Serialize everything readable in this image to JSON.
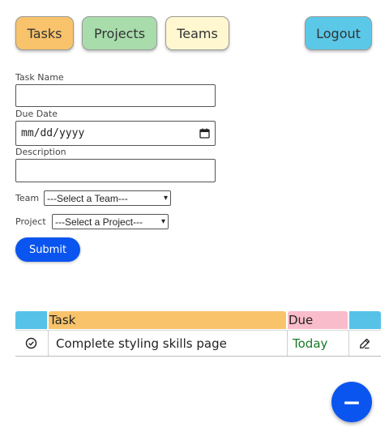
{
  "nav": {
    "tasks": "Tasks",
    "projects": "Projects",
    "teams": "Teams",
    "logout": "Logout"
  },
  "form": {
    "task_name_label": "Task Name",
    "task_name_value": "",
    "due_date_label": "Due Date",
    "due_date_placeholder": "mm/dd/yyyy",
    "description_label": "Description",
    "description_value": "",
    "team_label": "Team",
    "team_selected": "---Select a Team---",
    "project_label": "Project",
    "project_selected": "---Select a Project---",
    "submit_label": "Submit"
  },
  "table": {
    "headers": [
      "",
      "Task",
      "Due",
      ""
    ],
    "rows": [
      {
        "task": "Complete styling skills page",
        "due": "Today"
      }
    ]
  },
  "fab_label": "−",
  "colors": {
    "tasks": "#f8c36b",
    "projects": "#a8dcab",
    "teams": "#fff7cf",
    "logout": "#5bc8e8",
    "submit": "#0a55f0",
    "header_icon": "#56c2e8",
    "header_task": "#f8c36b",
    "header_due": "#f9bccb",
    "due_text": "#1a7a26",
    "fab": "#0a55f0"
  }
}
